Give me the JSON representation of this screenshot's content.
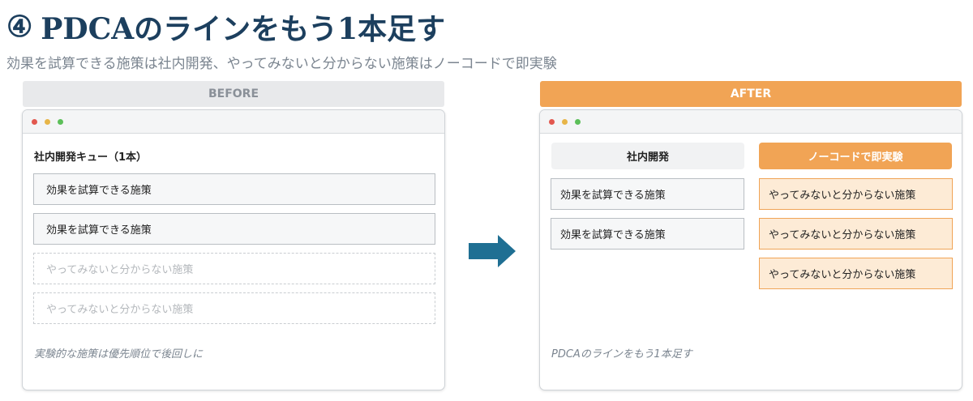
{
  "title": {
    "number": "④",
    "text": "PDCAのラインをもう1本足す"
  },
  "subtitle": "効果を試算できる施策は社内開発、やってみないと分からない施策はノーコードで即実験",
  "before": {
    "header": "BEFORE",
    "queue_title": "社内開発キュー（1本）",
    "items": [
      {
        "label": "効果を試算できる施策",
        "style": "solid"
      },
      {
        "label": "効果を試算できる施策",
        "style": "solid"
      },
      {
        "label": "やってみないと分からない施策",
        "style": "dashed"
      },
      {
        "label": "やってみないと分からない施策",
        "style": "dashed"
      }
    ],
    "note": "実験的な施策は優先順位で後回しに"
  },
  "after": {
    "header": "AFTER",
    "left_column": {
      "header": "社内開発",
      "items": [
        "効果を試算できる施策",
        "効果を試算できる施策"
      ]
    },
    "right_column": {
      "header": "ノーコードで即実験",
      "items": [
        "やってみないと分からない施策",
        "やってみないと分からない施策",
        "やってみないと分からない施策"
      ]
    },
    "note": "PDCAのラインをもう1本足す"
  },
  "colors": {
    "title": "#1c3f5e",
    "accent_orange": "#f1a455",
    "arrow": "#1f6f93",
    "orange_item_bg": "#fdebd6"
  },
  "icons": {
    "arrow": "right-arrow-icon"
  }
}
